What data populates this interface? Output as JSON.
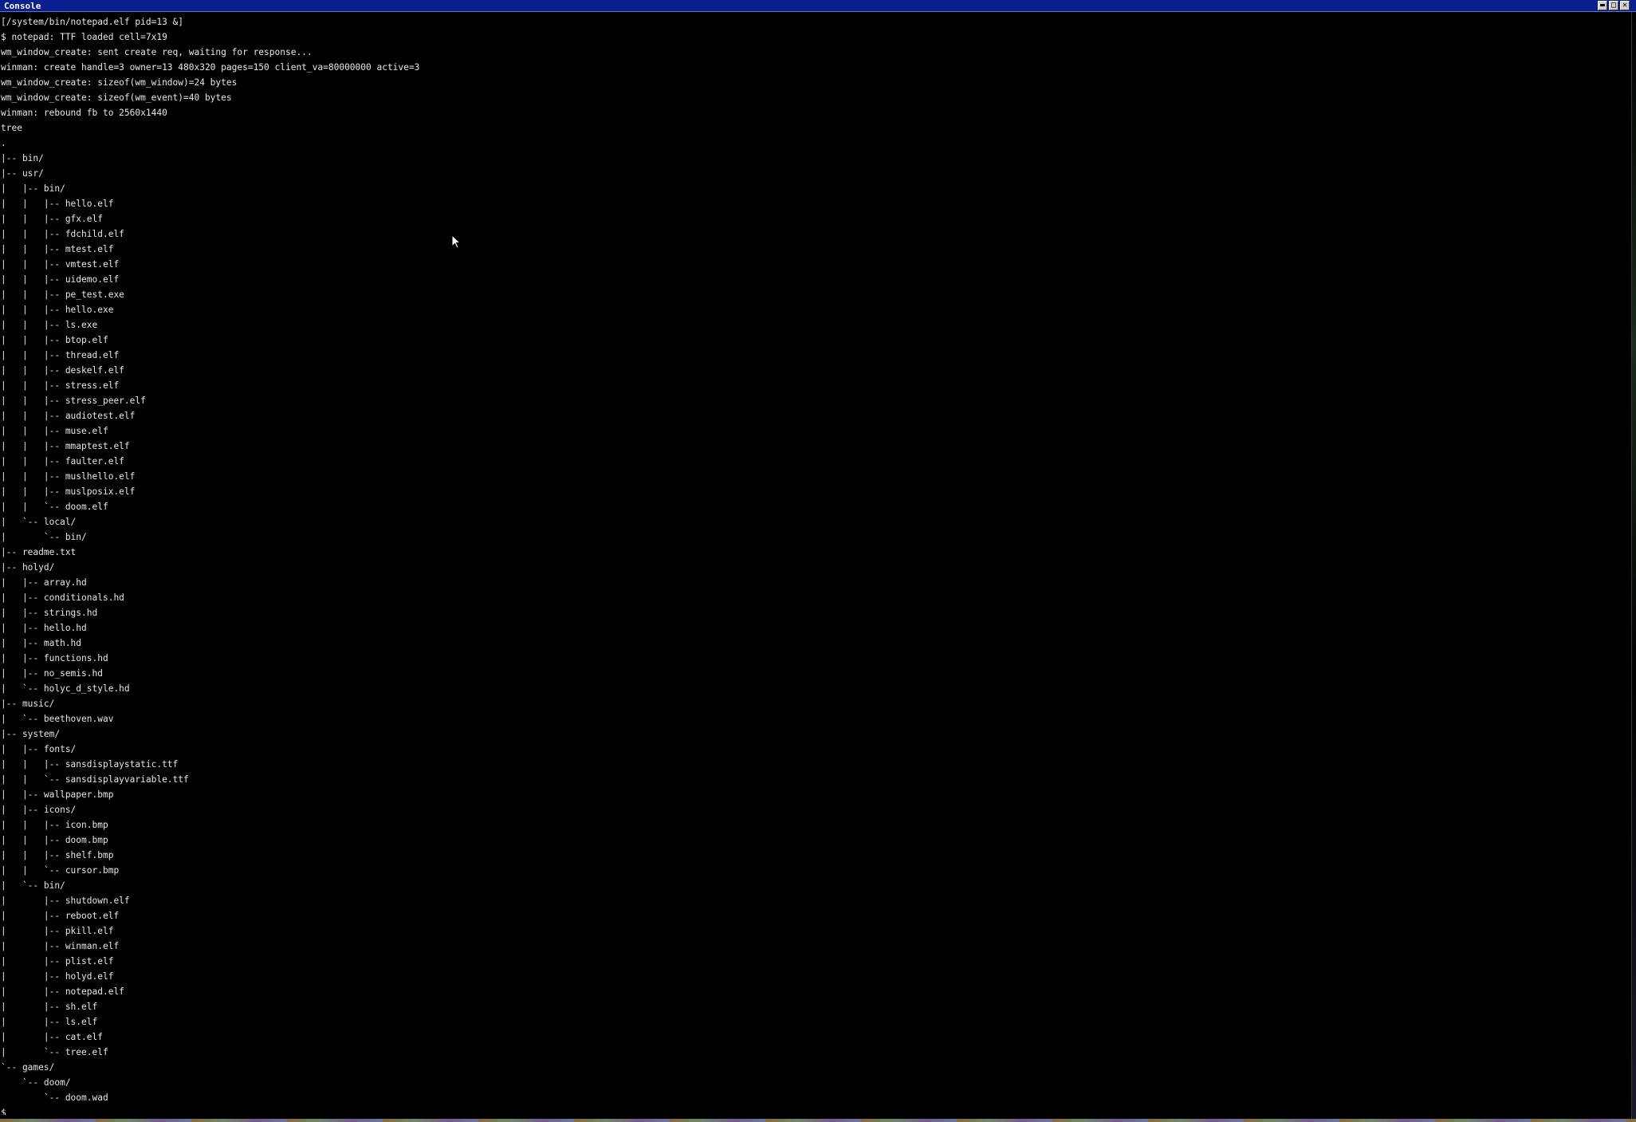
{
  "window": {
    "title": "Console",
    "minimize_label": "▬",
    "maximize_label": "□",
    "close_label": "✕"
  },
  "terminal": {
    "lines": [
      "[/system/bin/notepad.elf pid=13 &]",
      "$ notepad: TTF loaded cell=7x19",
      "wm_window_create: sent create req, waiting for response...",
      "winman: create handle=3 owner=13 480x320 pages=150 client_va=80000000 active=3",
      "wm_window_create: sizeof(wm_window)=24 bytes",
      "wm_window_create: sizeof(wm_event)=40 bytes",
      "winman: rebound fb to 2560x1440",
      "tree",
      ".",
      "|-- bin/",
      "|-- usr/",
      "|   |-- bin/",
      "|   |   |-- hello.elf",
      "|   |   |-- gfx.elf",
      "|   |   |-- fdchild.elf",
      "|   |   |-- mtest.elf",
      "|   |   |-- vmtest.elf",
      "|   |   |-- uidemo.elf",
      "|   |   |-- pe_test.exe",
      "|   |   |-- hello.exe",
      "|   |   |-- ls.exe",
      "|   |   |-- btop.elf",
      "|   |   |-- thread.elf",
      "|   |   |-- deskelf.elf",
      "|   |   |-- stress.elf",
      "|   |   |-- stress_peer.elf",
      "|   |   |-- audiotest.elf",
      "|   |   |-- muse.elf",
      "|   |   |-- mmaptest.elf",
      "|   |   |-- faulter.elf",
      "|   |   |-- muslhello.elf",
      "|   |   |-- muslposix.elf",
      "|   |   `-- doom.elf",
      "|   `-- local/",
      "|       `-- bin/",
      "|-- readme.txt",
      "|-- holyd/",
      "|   |-- array.hd",
      "|   |-- conditionals.hd",
      "|   |-- strings.hd",
      "|   |-- hello.hd",
      "|   |-- math.hd",
      "|   |-- functions.hd",
      "|   |-- no_semis.hd",
      "|   `-- holyc_d_style.hd",
      "|-- music/",
      "|   `-- beethoven.wav",
      "|-- system/",
      "|   |-- fonts/",
      "|   |   |-- sansdisplaystatic.ttf",
      "|   |   `-- sansdisplayvariable.ttf",
      "|   |-- wallpaper.bmp",
      "|   |-- icons/",
      "|   |   |-- icon.bmp",
      "|   |   |-- doom.bmp",
      "|   |   |-- shelf.bmp",
      "|   |   `-- cursor.bmp",
      "|   `-- bin/",
      "|       |-- shutdown.elf",
      "|       |-- reboot.elf",
      "|       |-- pkill.elf",
      "|       |-- winman.elf",
      "|       |-- plist.elf",
      "|       |-- holyd.elf",
      "|       |-- notepad.elf",
      "|       |-- sh.elf",
      "|       |-- ls.elf",
      "|       |-- cat.elf",
      "|       `-- tree.elf",
      "`-- games/",
      "    `-- doom/",
      "        `-- doom.wad",
      "$"
    ]
  },
  "colors": {
    "title_bar": "#0a1f8f",
    "background": "#000000",
    "text": "#e6e6e6"
  },
  "icons": {
    "cursor": "mouse-pointer-icon"
  }
}
